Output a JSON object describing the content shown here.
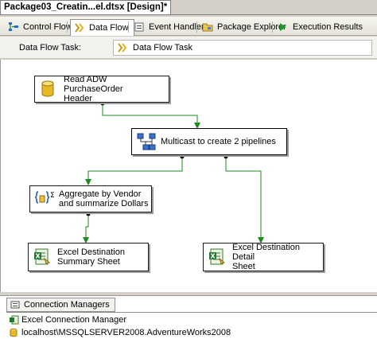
{
  "document": {
    "title": "Package03_Creatin...el.dtsx [Design]*"
  },
  "tabs": [
    {
      "label": "Control Flow",
      "icon": "control-flow-icon",
      "active": false
    },
    {
      "label": "Data Flow",
      "icon": "data-flow-icon",
      "active": true
    },
    {
      "label": "Event Handlers",
      "icon": "event-handlers-icon",
      "active": false
    },
    {
      "label": "Package Explorer",
      "icon": "package-explorer-icon",
      "active": false
    },
    {
      "label": "Execution Results",
      "icon": "execution-results-icon",
      "active": false
    }
  ],
  "task_selector": {
    "label": "Data Flow Task:",
    "value": "Data Flow Task"
  },
  "components": [
    {
      "label": "Read ADW PurchaseOrder\nHeader",
      "icon": "ole-db-source-icon"
    },
    {
      "label": "Multicast to create 2 pipelines",
      "icon": "multicast-icon"
    },
    {
      "label": "Aggregate by Vendor\nand summarize Dollars",
      "icon": "aggregate-icon"
    },
    {
      "label": "Excel Destination\nSummary Sheet",
      "icon": "excel-destination-icon"
    },
    {
      "label": "Excel Destination Detail\nSheet",
      "icon": "excel-destination-icon"
    }
  ],
  "connection_managers": {
    "tab_label": "Connection Managers",
    "items": [
      {
        "label": "Excel Connection Manager",
        "icon": "excel-connection-icon"
      },
      {
        "label": "localhost\\MSSQLSERVER2008.AdventureWorks2008",
        "icon": "database-connection-icon"
      }
    ]
  },
  "colors": {
    "path_green": "#1f8a1f",
    "canvas_bg": "#ffffff",
    "chrome_bg": "#ece9d8"
  }
}
